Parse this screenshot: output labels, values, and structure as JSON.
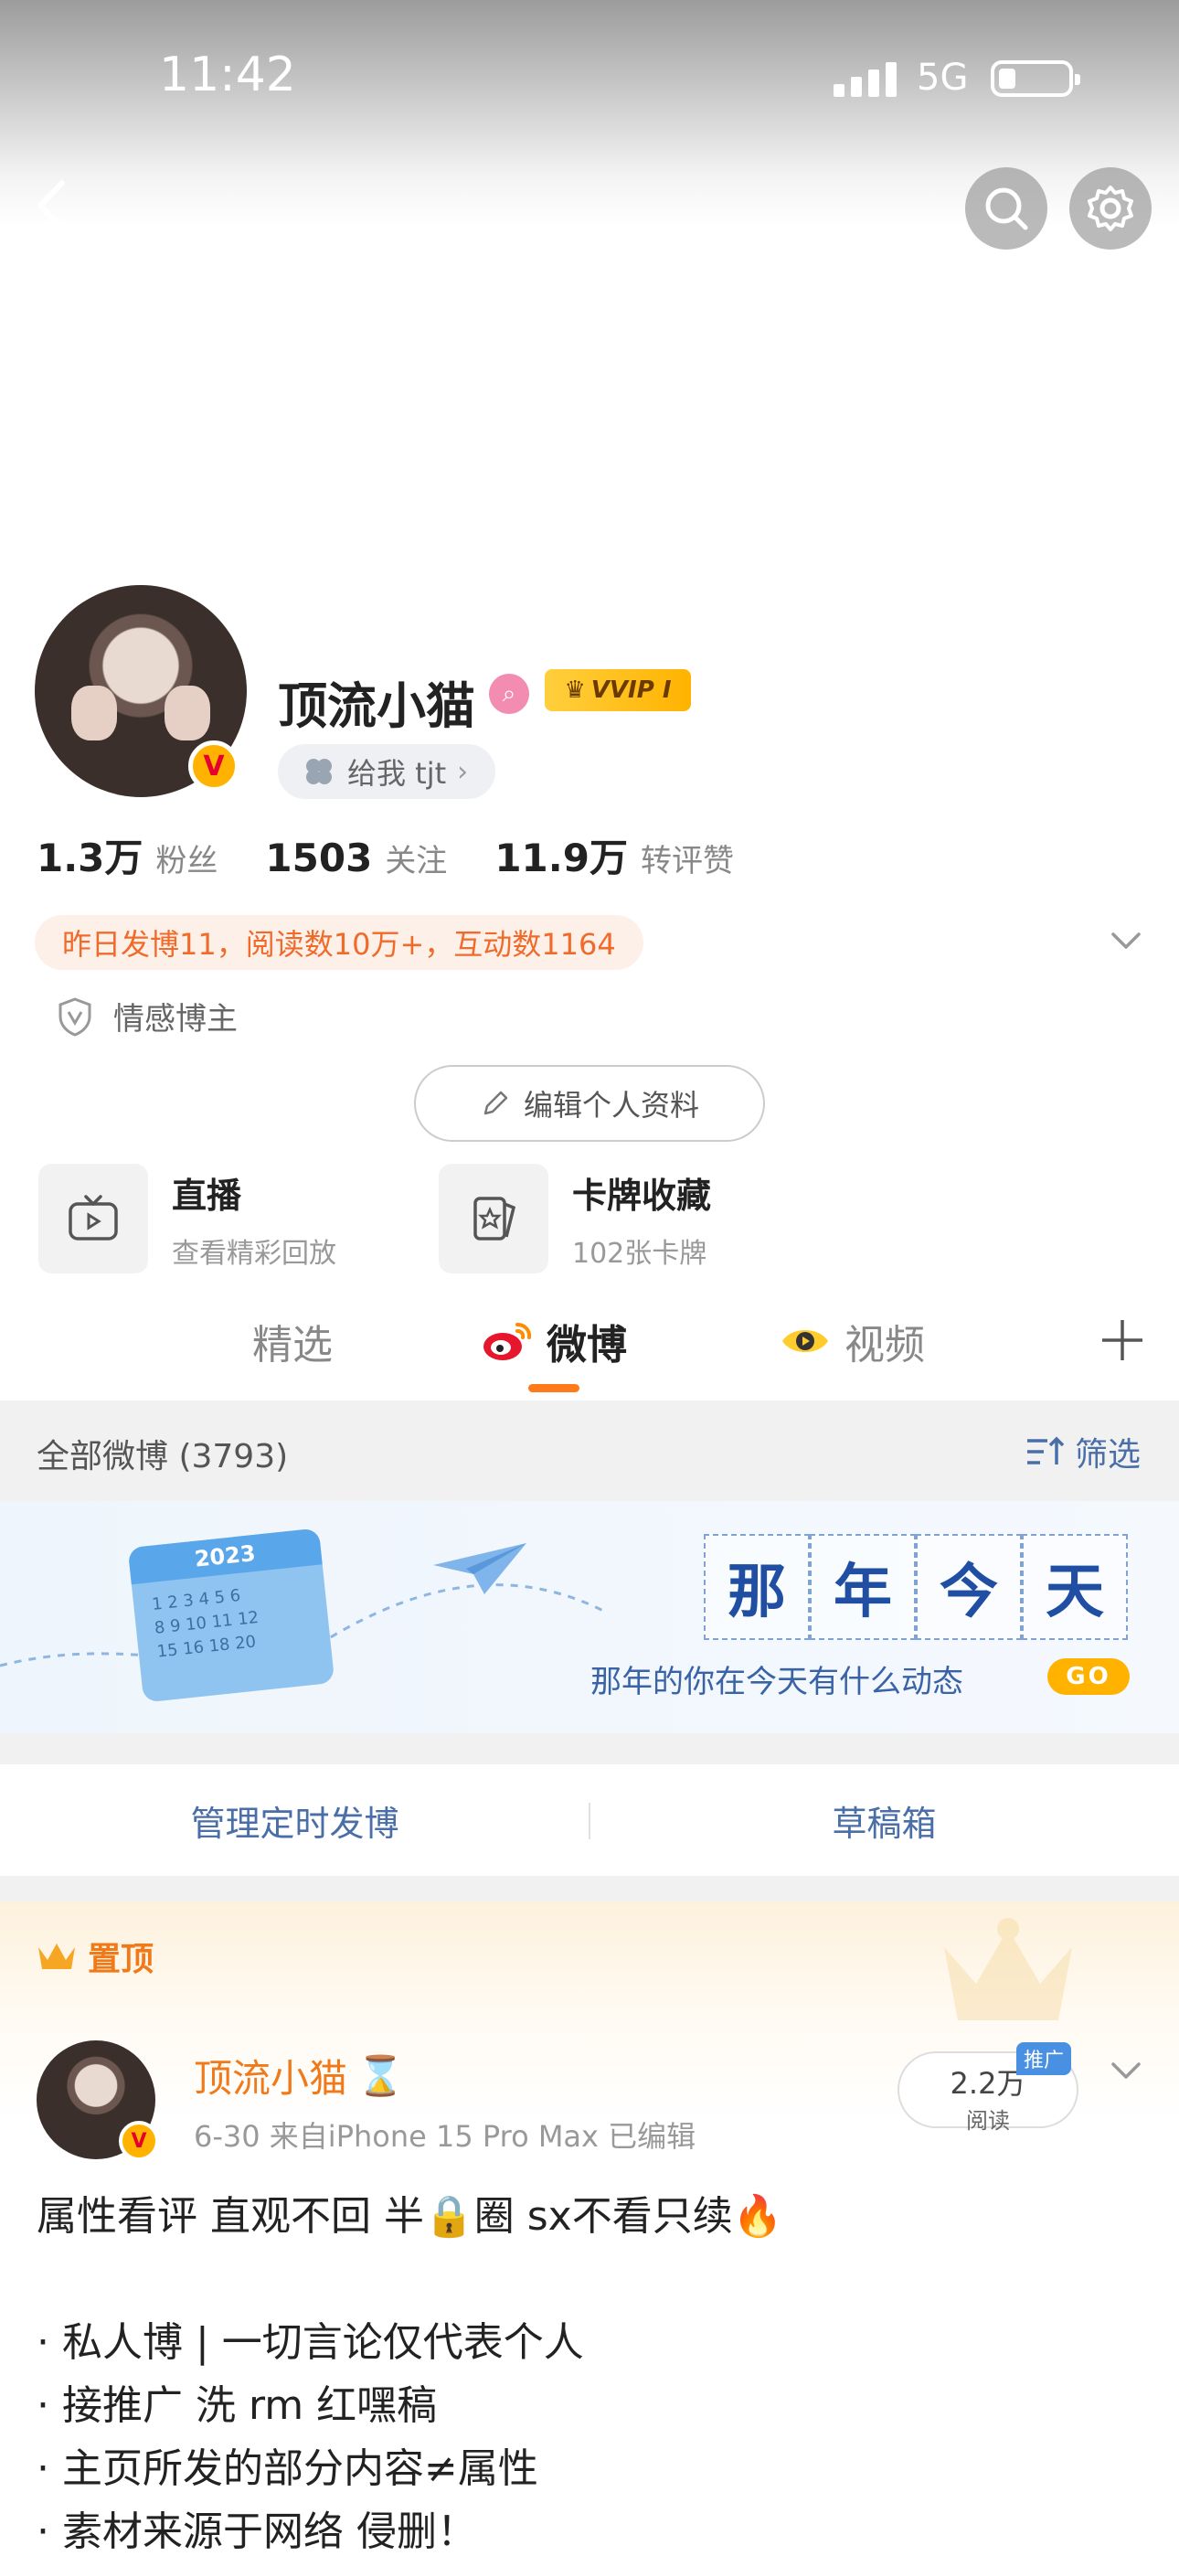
{
  "status": {
    "time": "11:42",
    "network": "5G"
  },
  "profile": {
    "name": "顶流小猫",
    "vip_label": "VVIP I",
    "verified_mark": "V",
    "tag": "给我 tjt",
    "stats": [
      {
        "value": "1.3万",
        "label": "粉丝"
      },
      {
        "value": "1503",
        "label": "关注"
      },
      {
        "value": "11.9万",
        "label": "转评赞"
      }
    ],
    "daily_summary": "昨日发博11，阅读数10万+，互动数1164",
    "blogger_type": "情感博主",
    "edit_button": "编辑个人资料"
  },
  "features": [
    {
      "title": "直播",
      "subtitle": "查看精彩回放",
      "icon": "tv-icon"
    },
    {
      "title": "卡牌收藏",
      "subtitle": "102张卡牌",
      "icon": "card-icon"
    }
  ],
  "tabs": [
    {
      "label": "精选",
      "active": false
    },
    {
      "label": "微博",
      "active": true,
      "icon": "weibo-logo-icon"
    },
    {
      "label": "视频",
      "active": false,
      "icon": "video-eye-icon"
    }
  ],
  "filter_bar": {
    "all_posts": "全部微博 (3793)",
    "filter": "筛选"
  },
  "banner": {
    "calendar_year": "2023",
    "title_chars": [
      "那",
      "年",
      "今",
      "天"
    ],
    "subtitle": "那年的你在今天有什么动态",
    "go": "GO"
  },
  "manage": {
    "scheduled": "管理定时发博",
    "drafts": "草稿箱"
  },
  "pinned_post": {
    "pin_label": "置顶",
    "author": "顶流小猫",
    "meta": "6-30  来自iPhone 15 Pro Max  已编辑",
    "promo_badge": "推广",
    "reads_value": "2.2万",
    "reads_label": "阅读",
    "text": "属性看评 直观不回 半🔒圈 sx不看只续🔥\n\n· 私人博 | 一切言论仅代表个人\n· 接推广 洗 rm 红嘿稿\n· 主页所发的部分内容≠属性\n· 素材来源于网络 侵删！"
  },
  "colors": {
    "accent": "#ff7a1a",
    "link": "#4a6ea8",
    "orange_text": "#f06a2a"
  }
}
